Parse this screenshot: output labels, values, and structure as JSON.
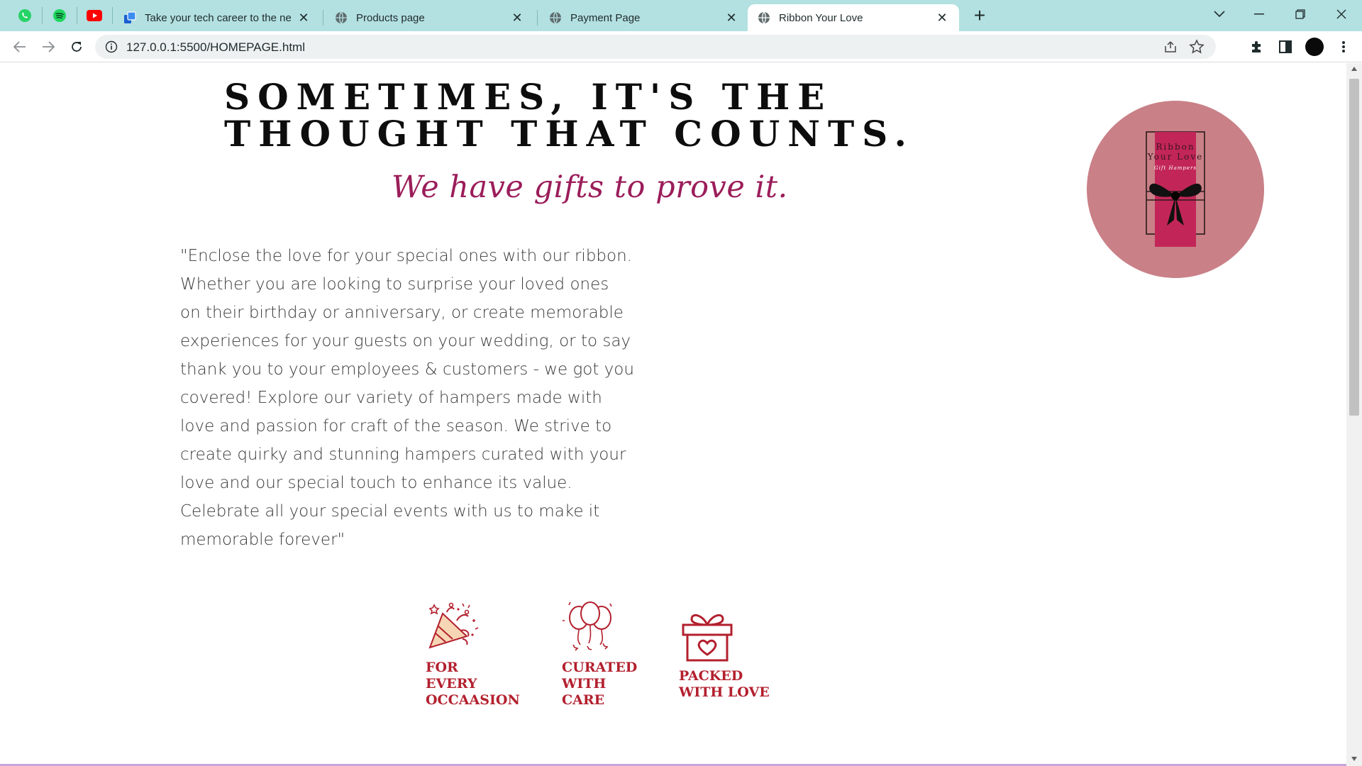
{
  "browser": {
    "tabs": [
      {
        "title": "Take your tech career to the next",
        "active": false
      },
      {
        "title": "Products page",
        "active": false
      },
      {
        "title": "Payment Page",
        "active": false
      },
      {
        "title": "Ribbon Your Love",
        "active": true
      }
    ],
    "url": "127.0.0.1:5500/HOMEPAGE.html"
  },
  "page": {
    "headline_line1": "SOMETIMES, IT'S THE",
    "headline_line2": "THOUGHT THAT COUNTS.",
    "tagline": "We have gifts to prove it.",
    "about": "\"Enclose the love for your special ones with our ribbon. Whether you are looking to surprise your loved ones on their birthday or anniversary, or create memorable experiences for your guests on your wedding, or to say thank you to your employees & customers - we got you covered! Explore our variety of hampers made with love and passion for craft of the season. We strive to create quirky and stunning hampers curated with your love and our special touch to enhance its value. Celebrate all your special events with us to make it memorable forever\"",
    "logo": {
      "line1": "Ribbon",
      "line2": "Your Love",
      "line3": "Gift Hampers"
    },
    "features": [
      {
        "label": "FOR\nEVERY\nOCCAASION",
        "icon": "party-popper-icon"
      },
      {
        "label": "CURATED\nWITH\nCARE",
        "icon": "balloons-icon"
      },
      {
        "label": "PACKED\nWITH LOVE",
        "icon": "gift-box-icon"
      }
    ]
  },
  "colors": {
    "tab_strip": "#b3e0e1",
    "tagline": "#9b1d5a",
    "feature": "#b3202e",
    "logo_bg": "#c98087",
    "logo_band": "#c22658"
  }
}
